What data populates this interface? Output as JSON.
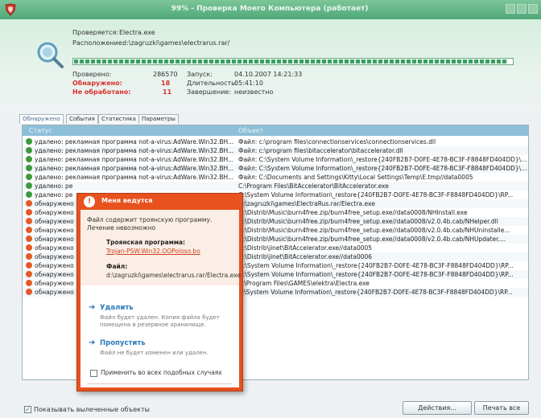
{
  "window": {
    "title": "99% - Проверка Моего Компьютера (работает)",
    "icon": "kaspersky-logo-icon"
  },
  "scan": {
    "checking_label": "Проверяется:",
    "checking_value": "Electra.exe",
    "location_label": "Расположение:",
    "location_value": "d:\\zagruzki\\games\\electrarus.rar/",
    "progress_percent": 99,
    "checked_label": "Проверено:",
    "checked_value": "286570",
    "detected_label": "Обнаружено:",
    "detected_value": "18",
    "unprocessed_label": "Не обработано:",
    "unprocessed_value": "11",
    "launch_label": "Запуск:",
    "launch_value": "04.10.2007 14:21:33",
    "duration_label": "Длительность:",
    "duration_value": "05:41:10",
    "end_label": "Завершение:",
    "end_value": "неизвестно"
  },
  "tabs": [
    {
      "label": "Обнаружено",
      "active": true
    },
    {
      "label": "События",
      "active": false
    },
    {
      "label": "Статистика",
      "active": false
    },
    {
      "label": "Параметры",
      "active": false
    }
  ],
  "table": {
    "columns": [
      "Статус",
      "Объект"
    ],
    "rows": [
      {
        "type": "ok",
        "status": "удалено: рекламная программа not-a-virus:AdWare.Win32.BH...",
        "object": "Файл: c:\\program files\\connectionservices\\connectionservices.dll"
      },
      {
        "type": "ok",
        "status": "удалено: рекламная программа not-a-virus:AdWare.Win32.BH...",
        "object": "Файл: c:\\program files\\bitaccelerator\\bitaccelerator.dll"
      },
      {
        "type": "ok",
        "status": "удалено: рекламная программа not-a-virus:AdWare.Win32.BH...",
        "object": "Файл: C:\\System Volume Information\\_restore{240FB2B7-D0FE-4E78-BC3F-F8848FD404DD}\\RP..."
      },
      {
        "type": "ok",
        "status": "удалено: рекламная программа not-a-virus:AdWare.Win32.BH...",
        "object": "Файл: C:\\System Volume Information\\_restore{240FB2B7-D0FE-4E78-BC3F-F8848FD404DD}\\RP..."
      },
      {
        "type": "ok",
        "status": "удалено: рекламная программа not-a-virus:AdWare.Win32.BH...",
        "object": "Файл: C:\\Documents and Settings\\Kitty\\Local Settings\\Temp\\E.tmp//data0005"
      },
      {
        "type": "ok",
        "status": "удалено: ре",
        "object": "C:\\Program Files\\BitAccelerator\\BitAccelerator.exe"
      },
      {
        "type": "ok",
        "status": "удалено: ре",
        "object": "C:\\System Volume Information\\_restore{240FB2B7-D0FE-4E78-BC3F-F8848FD404DD}\\RP..."
      },
      {
        "type": "bad",
        "status": "обнаружено",
        "object": "D:\\zagruzki\\games\\ElectraRus.rar/Electra.exe"
      },
      {
        "type": "bad",
        "status": "обнаружено",
        "object": "D:\\Distrib\\Music\\burn4free.zip/burn4free_setup.exe//data0008/NHInstall.exe"
      },
      {
        "type": "bad",
        "status": "обнаружено",
        "object": "D:\\Distrib\\Music\\burn4free.zip/burn4free_setup.exe//data0008/v2.0.4b.cab/NHelper.dll"
      },
      {
        "type": "bad",
        "status": "обнаружено",
        "object": "D:\\Distrib\\Music\\burn4free.zip/burn4free_setup.exe//data0008/v2.0.4b.cab/NHUninstalle..."
      },
      {
        "type": "bad",
        "status": "обнаружено",
        "object": "D:\\Distrib\\Music\\burn4free.zip/burn4free_setup.exe//data0008/v2.0.4b.cab/NHUpdater...."
      },
      {
        "type": "bad",
        "status": "обнаружено",
        "object": "D:\\Distrib\\jinet\\BitAccelerator.exe//data0005"
      },
      {
        "type": "bad",
        "status": "обнаружено",
        "object": "D:\\Distrib\\jinet\\BitAccelerator.exe//data0006"
      },
      {
        "type": "bad",
        "status": "обнаружено",
        "object": "D:\\System Volume Information\\_restore{240FB2B7-D0FE-4E78-BC3F-F8848FD404DD}\\RP..."
      },
      {
        "type": "bad",
        "status": "обнаружено",
        "object": "D:\\System Volume Information\\_restore{240FB2B7-D0FE-4E78-BC3F-F8848FD404DD}\\RP..."
      },
      {
        "type": "bad",
        "status": "обнаружено",
        "object": "E:\\Program Files\\GAMES\\elektra\\Electra.exe"
      },
      {
        "type": "bad",
        "status": "обнаружено",
        "object": "E:\\System Volume Information\\_restore{240FB2B7-D0FE-4E78-BC3F-F8848FD404DD}\\RP..."
      }
    ]
  },
  "dialog": {
    "title": "Меня ведутся",
    "message": "Файл содержит троянскую программу. Лечение невозможно",
    "trojan_label": "Троянская программа:",
    "trojan_value": "Trojan-PSW.Win32.OOPoloso.bo",
    "file_label": "Файл:",
    "file_value": "d:\\zagruzki\\games\\electrarus.rar/Electra.exe",
    "delete_title": "Удалить",
    "delete_desc": "Файл будет удален. Копия файла будет помещена в резервное хранилище.",
    "skip_title": "Пропустить",
    "skip_desc": "Файл не будет изменен или удален.",
    "apply_all_label": "Применить во всех подобных случаях"
  },
  "footer": {
    "show_neutralized_label": "Показывать вылеченные объекты",
    "show_neutralized_checked": true,
    "actions_button": "Действия...",
    "print_button": "Печать все"
  },
  "colors": {
    "titlebar": "#4fa877",
    "progress": "#38a061",
    "dialog": "#e8521f",
    "link": "#2a7ab8",
    "ok_status": "#3d9b3d",
    "threat_status": "#e35a28"
  }
}
